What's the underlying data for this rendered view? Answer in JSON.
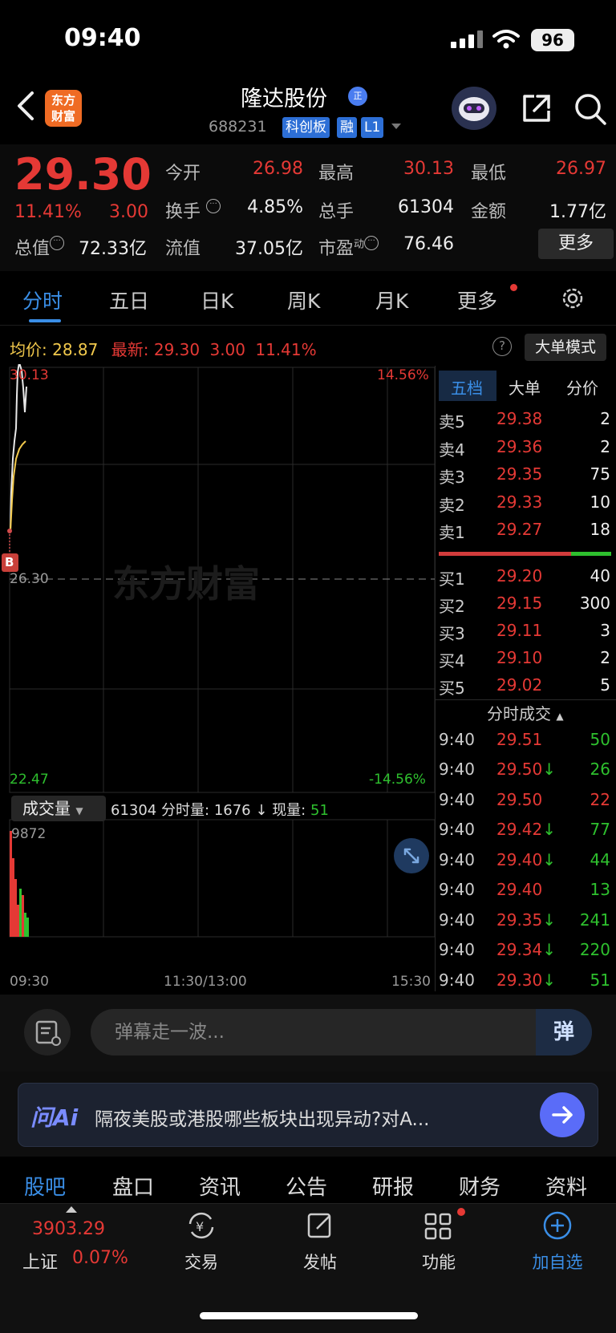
{
  "status_bar": {
    "time": "09:40",
    "battery": "96"
  },
  "header": {
    "logo_text": "东方财富",
    "stock_name": "隆达股份",
    "name_badge": "正",
    "stock_code": "688231",
    "tags": [
      "科创板",
      "融",
      "L1"
    ]
  },
  "quote": {
    "price": "29.30",
    "change_pct": "11.41%",
    "change": "3.00",
    "fields": [
      {
        "label": "今开",
        "value": "26.98",
        "color": "red"
      },
      {
        "label": "最高",
        "value": "30.13",
        "color": "red"
      },
      {
        "label": "最低",
        "value": "26.97",
        "color": "red"
      },
      {
        "label": "换手",
        "value": "4.85%",
        "color": "white"
      },
      {
        "label": "总手",
        "value": "61304",
        "color": "white"
      },
      {
        "label": "金额",
        "value": "1.77亿",
        "color": "white"
      },
      {
        "label": "总值",
        "value": "72.33亿",
        "color": "white"
      },
      {
        "label": "流值",
        "value": "37.05亿",
        "color": "white"
      },
      {
        "label": "市盈",
        "label_sup": "动",
        "value": "76.46",
        "color": "white"
      }
    ],
    "more_button": "更多"
  },
  "chart_tabs": [
    "分时",
    "五日",
    "日K",
    "周K",
    "月K",
    "更多"
  ],
  "avg_row": {
    "avg_label": "均价:",
    "avg_value": "28.87",
    "latest_label": "最新:",
    "latest_value": "29.30",
    "latest_change": "3.00",
    "latest_pct": "11.41%",
    "help": "?",
    "big_order_mode": "大单模式"
  },
  "chart": {
    "high_label": "30.13",
    "high_pct": "14.56%",
    "mid_label": "26.30",
    "low_label": "22.47",
    "low_pct": "-14.56%",
    "buy_marker": "B",
    "watermark": "东方财富",
    "volume_select": "成交量",
    "volume_info_total": "61304",
    "volume_info_minute_label": "分时量:",
    "volume_info_minute": "1676",
    "volume_info_now_label": "现量:",
    "volume_info_now": "51",
    "volume_max": "9872",
    "time_start": "09:30",
    "time_mid": "11:30/13:00",
    "time_end": "15:30"
  },
  "order_book": {
    "tabs": [
      "五档",
      "大单",
      "分价"
    ],
    "asks": [
      {
        "label": "卖5",
        "price": "29.38",
        "vol": "2"
      },
      {
        "label": "卖4",
        "price": "29.36",
        "vol": "2"
      },
      {
        "label": "卖3",
        "price": "29.35",
        "vol": "75"
      },
      {
        "label": "卖2",
        "price": "29.33",
        "vol": "10"
      },
      {
        "label": "卖1",
        "price": "29.27",
        "vol": "18"
      }
    ],
    "bids": [
      {
        "label": "买1",
        "price": "29.20",
        "vol": "40"
      },
      {
        "label": "买2",
        "price": "29.15",
        "vol": "300"
      },
      {
        "label": "买3",
        "price": "29.11",
        "vol": "3"
      },
      {
        "label": "买4",
        "price": "29.10",
        "vol": "2"
      },
      {
        "label": "买5",
        "price": "29.02",
        "vol": "5"
      }
    ],
    "ticks_title": "分时成交",
    "ticks": [
      {
        "time": "9:40",
        "price": "29.51",
        "arrow": "",
        "vol": "50",
        "color": "green"
      },
      {
        "time": "9:40",
        "price": "29.50",
        "arrow": "↓",
        "vol": "26",
        "color": "green"
      },
      {
        "time": "9:40",
        "price": "29.50",
        "arrow": "",
        "vol": "22",
        "color": "red"
      },
      {
        "time": "9:40",
        "price": "29.42",
        "arrow": "↓",
        "vol": "77",
        "color": "green"
      },
      {
        "time": "9:40",
        "price": "29.40",
        "arrow": "↓",
        "vol": "44",
        "color": "green"
      },
      {
        "time": "9:40",
        "price": "29.40",
        "arrow": "",
        "vol": "13",
        "color": "green"
      },
      {
        "time": "9:40",
        "price": "29.35",
        "arrow": "↓",
        "vol": "241",
        "color": "green"
      },
      {
        "time": "9:40",
        "price": "29.34",
        "arrow": "↓",
        "vol": "220",
        "color": "green"
      },
      {
        "time": "9:40",
        "price": "29.30",
        "arrow": "↓",
        "vol": "51",
        "color": "green"
      }
    ]
  },
  "comment": {
    "placeholder": "弹幕走一波...",
    "danmu_button": "弹"
  },
  "ai": {
    "logo": "问Ai",
    "prompt": "隔夜美股或港股哪些板块出现异动?对A..."
  },
  "bottom_tabs": [
    "股吧",
    "盘口",
    "资讯",
    "公告",
    "研报",
    "财务",
    "资料"
  ],
  "bottom_nav": {
    "index_value": "3903.29",
    "index_name": "上证",
    "index_pct": "0.07%",
    "items": [
      "交易",
      "发帖",
      "功能",
      "加自选"
    ]
  }
}
